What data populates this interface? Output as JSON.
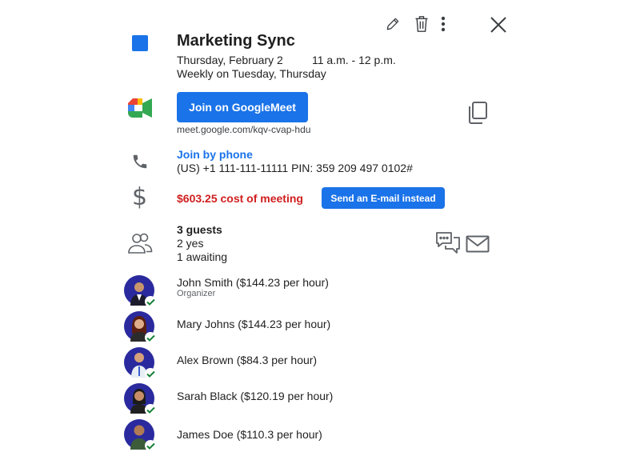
{
  "event": {
    "title": "Marketing Sync",
    "date": "Thursday, February 2",
    "time": "11 a.m. - 12 p.m.",
    "recurrence": "Weekly on Tuesday, Thursday",
    "color": "#1a73e8"
  },
  "toolbar": {
    "edit_icon": "pencil-icon",
    "delete_icon": "trash-icon",
    "more_icon": "kebab-icon",
    "close_icon": "close-icon"
  },
  "meet": {
    "join_label": "Join on GoogleMeet",
    "link": "meet.google.com/kqv-cvap-hdu",
    "copy_icon": "copy-icon"
  },
  "phone": {
    "join_label": "Join by phone",
    "number": "(US) +1 111-111-11111 PIN: 359 209 497 0102#"
  },
  "cost": {
    "text": "$603.25 cost of meeting",
    "email_button": "Send an E-mail instead"
  },
  "guests": {
    "summary": "3 guests",
    "yes": "2 yes",
    "awaiting": "1 awaiting",
    "list": [
      {
        "name": "John Smith ($144.23 per hour)",
        "role": "Organizer"
      },
      {
        "name": "Mary Johns ($144.23 per hour)"
      },
      {
        "name": "Alex Brown ($84.3 per hour)"
      },
      {
        "name": "Sarah Black ($120.19 per hour)"
      },
      {
        "name": "James Doe ($110.3 per hour)"
      }
    ]
  },
  "colors": {
    "accent": "#1a73e8",
    "cost_red": "#d01e1e",
    "avatar_bg": "#2a2a9e",
    "check_green": "#188038"
  }
}
